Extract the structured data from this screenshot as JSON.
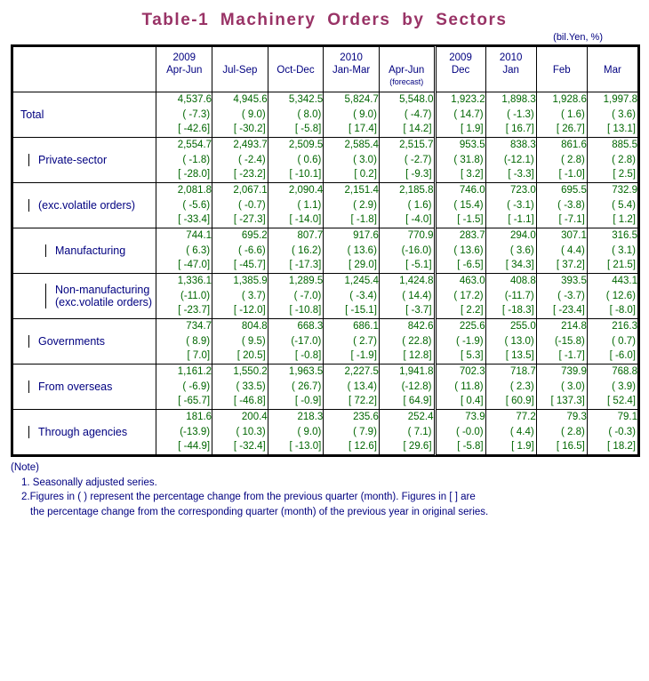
{
  "title": "Table-1  Machinery  Orders  by  Sectors",
  "units": "(bil.Yen, %)",
  "colors": {
    "title": "#993366",
    "label": "#000080",
    "value": "#006600",
    "border": "#000000"
  },
  "header": {
    "corner": "",
    "columns": [
      {
        "year": "2009",
        "period": "Apr-Jun",
        "sub": ""
      },
      {
        "year": "",
        "period": "Jul-Sep",
        "sub": ""
      },
      {
        "year": "",
        "period": "Oct-Dec",
        "sub": ""
      },
      {
        "year": "2010",
        "period": "Jan-Mar",
        "sub": ""
      },
      {
        "year": "",
        "period": "Apr-Jun",
        "sub": "(forecast)"
      },
      {
        "year": "2009",
        "period": "Dec",
        "sub": ""
      },
      {
        "year": "2010",
        "period": "Jan",
        "sub": ""
      },
      {
        "year": "",
        "period": "Feb",
        "sub": ""
      },
      {
        "year": "",
        "period": "Mar",
        "sub": ""
      }
    ]
  },
  "rows": [
    {
      "label": "Total",
      "label2": "",
      "level": 0,
      "cells": [
        {
          "value": "4,537.6",
          "qoq": "( -7.3)",
          "yoy": "[ -42.6]"
        },
        {
          "value": "4,945.6",
          "qoq": "(  9.0)",
          "yoy": "[ -30.2]"
        },
        {
          "value": "5,342.5",
          "qoq": "(  8.0)",
          "yoy": "[  -5.8]"
        },
        {
          "value": "5,824.7",
          "qoq": "(  9.0)",
          "yoy": "[  17.4]"
        },
        {
          "value": "5,548.0",
          "qoq": "( -4.7)",
          "yoy": "[  14.2]"
        },
        {
          "value": "1,923.2",
          "qoq": "( 14.7)",
          "yoy": "[   1.9]"
        },
        {
          "value": "1,898.3",
          "qoq": "( -1.3)",
          "yoy": "[  16.7]"
        },
        {
          "value": "1,928.6",
          "qoq": "(  1.6)",
          "yoy": "[  26.7]"
        },
        {
          "value": "1,997.8",
          "qoq": "(  3.6)",
          "yoy": "[  13.1]"
        }
      ]
    },
    {
      "label": "Private-sector",
      "label2": "",
      "level": 1,
      "cells": [
        {
          "value": "2,554.7",
          "qoq": "( -1.8)",
          "yoy": "[ -28.0]"
        },
        {
          "value": "2,493.7",
          "qoq": "( -2.4)",
          "yoy": "[ -23.2]"
        },
        {
          "value": "2,509.5",
          "qoq": "(  0.6)",
          "yoy": "[ -10.1]"
        },
        {
          "value": "2,585.4",
          "qoq": "(  3.0)",
          "yoy": "[   0.2]"
        },
        {
          "value": "2,515.7",
          "qoq": "( -2.7)",
          "yoy": "[  -9.3]"
        },
        {
          "value": "953.5",
          "qoq": "( 31.8)",
          "yoy": "[   3.2]"
        },
        {
          "value": "838.3",
          "qoq": "(-12.1)",
          "yoy": "[  -3.3]"
        },
        {
          "value": "861.6",
          "qoq": "(  2.8)",
          "yoy": "[  -1.0]"
        },
        {
          "value": "885.5",
          "qoq": "(  2.8)",
          "yoy": "[   2.5]"
        }
      ]
    },
    {
      "label": "(exc.volatile orders)",
      "label2": "",
      "level": 1,
      "cells": [
        {
          "value": "2,081.8",
          "qoq": "( -5.6)",
          "yoy": "[ -33.4]"
        },
        {
          "value": "2,067.1",
          "qoq": "( -0.7)",
          "yoy": "[ -27.3]"
        },
        {
          "value": "2,090.4",
          "qoq": "(  1.1)",
          "yoy": "[ -14.0]"
        },
        {
          "value": "2,151.4",
          "qoq": "(  2.9)",
          "yoy": "[  -1.8]"
        },
        {
          "value": "2,185.8",
          "qoq": "(  1.6)",
          "yoy": "[  -4.0]"
        },
        {
          "value": "746.0",
          "qoq": "( 15.4)",
          "yoy": "[  -1.5]"
        },
        {
          "value": "723.0",
          "qoq": "( -3.1)",
          "yoy": "[  -1.1]"
        },
        {
          "value": "695.5",
          "qoq": "( -3.8)",
          "yoy": "[  -7.1]"
        },
        {
          "value": "732.9",
          "qoq": "(  5.4)",
          "yoy": "[   1.2]"
        }
      ]
    },
    {
      "label": "Manufacturing",
      "label2": "",
      "level": 2,
      "cells": [
        {
          "value": "744.1",
          "qoq": "(  6.3)",
          "yoy": "[ -47.0]"
        },
        {
          "value": "695.2",
          "qoq": "( -6.6)",
          "yoy": "[ -45.7]"
        },
        {
          "value": "807.7",
          "qoq": "( 16.2)",
          "yoy": "[ -17.3]"
        },
        {
          "value": "917.6",
          "qoq": "( 13.6)",
          "yoy": "[  29.0]"
        },
        {
          "value": "770.9",
          "qoq": "(-16.0)",
          "yoy": "[  -5.1]"
        },
        {
          "value": "283.7",
          "qoq": "( 13.6)",
          "yoy": "[  -6.5]"
        },
        {
          "value": "294.0",
          "qoq": "(  3.6)",
          "yoy": "[  34.3]"
        },
        {
          "value": "307.1",
          "qoq": "(  4.4)",
          "yoy": "[  37.2]"
        },
        {
          "value": "316.5",
          "qoq": "(  3.1)",
          "yoy": "[  21.5]"
        }
      ]
    },
    {
      "label": "Non-manufacturing",
      "label2": "(exc.volatile orders)",
      "level": 2,
      "cells": [
        {
          "value": "1,336.1",
          "qoq": "(-11.0)",
          "yoy": "[ -23.7]"
        },
        {
          "value": "1,385.9",
          "qoq": "(  3.7)",
          "yoy": "[ -12.0]"
        },
        {
          "value": "1,289.5",
          "qoq": "( -7.0)",
          "yoy": "[ -10.8]"
        },
        {
          "value": "1,245.4",
          "qoq": "( -3.4)",
          "yoy": "[ -15.1]"
        },
        {
          "value": "1,424.8",
          "qoq": "( 14.4)",
          "yoy": "[  -3.7]"
        },
        {
          "value": "463.0",
          "qoq": "( 17.2)",
          "yoy": "[   2.2]"
        },
        {
          "value": "408.8",
          "qoq": "(-11.7)",
          "yoy": "[ -18.3]"
        },
        {
          "value": "393.5",
          "qoq": "( -3.7)",
          "yoy": "[ -23.4]"
        },
        {
          "value": "443.1",
          "qoq": "( 12.6)",
          "yoy": "[  -8.0]"
        }
      ]
    },
    {
      "label": "Governments",
      "label2": "",
      "level": 1,
      "cells": [
        {
          "value": "734.7",
          "qoq": "(  8.9)",
          "yoy": "[   7.0]"
        },
        {
          "value": "804.8",
          "qoq": "(  9.5)",
          "yoy": "[  20.5]"
        },
        {
          "value": "668.3",
          "qoq": "(-17.0)",
          "yoy": "[  -0.8]"
        },
        {
          "value": "686.1",
          "qoq": "(  2.7)",
          "yoy": "[  -1.9]"
        },
        {
          "value": "842.6",
          "qoq": "( 22.8)",
          "yoy": "[  12.8]"
        },
        {
          "value": "225.6",
          "qoq": "( -1.9)",
          "yoy": "[   5.3]"
        },
        {
          "value": "255.0",
          "qoq": "( 13.0)",
          "yoy": "[  13.5]"
        },
        {
          "value": "214.8",
          "qoq": "(-15.8)",
          "yoy": "[  -1.7]"
        },
        {
          "value": "216.3",
          "qoq": "(  0.7)",
          "yoy": "[  -6.0]"
        }
      ]
    },
    {
      "label": "From overseas",
      "label2": "",
      "level": 1,
      "cells": [
        {
          "value": "1,161.2",
          "qoq": "( -6.9)",
          "yoy": "[ -65.7]"
        },
        {
          "value": "1,550.2",
          "qoq": "( 33.5)",
          "yoy": "[ -46.8]"
        },
        {
          "value": "1,963.5",
          "qoq": "( 26.7)",
          "yoy": "[  -0.9]"
        },
        {
          "value": "2,227.5",
          "qoq": "( 13.4)",
          "yoy": "[  72.2]"
        },
        {
          "value": "1,941.8",
          "qoq": "(-12.8)",
          "yoy": "[  64.9]"
        },
        {
          "value": "702.3",
          "qoq": "( 11.8)",
          "yoy": "[   0.4]"
        },
        {
          "value": "718.7",
          "qoq": "(  2.3)",
          "yoy": "[  60.9]"
        },
        {
          "value": "739.9",
          "qoq": "(  3.0)",
          "yoy": "[ 137.3]"
        },
        {
          "value": "768.8",
          "qoq": "(  3.9)",
          "yoy": "[  52.4]"
        }
      ]
    },
    {
      "label": "Through agencies",
      "label2": "",
      "level": 1,
      "cells": [
        {
          "value": "181.6",
          "qoq": "(-13.9)",
          "yoy": "[ -44.9]"
        },
        {
          "value": "200.4",
          "qoq": "( 10.3)",
          "yoy": "[ -32.4]"
        },
        {
          "value": "218.3",
          "qoq": "(  9.0)",
          "yoy": "[ -13.0]"
        },
        {
          "value": "235.6",
          "qoq": "(  7.9)",
          "yoy": "[  12.6]"
        },
        {
          "value": "252.4",
          "qoq": "(  7.1)",
          "yoy": "[  29.6]"
        },
        {
          "value": "73.9",
          "qoq": "( -0.0)",
          "yoy": "[  -5.8]"
        },
        {
          "value": "77.2",
          "qoq": "(  4.4)",
          "yoy": "[   1.9]"
        },
        {
          "value": "79.3",
          "qoq": "(  2.8)",
          "yoy": "[  16.5]"
        },
        {
          "value": "79.1",
          "qoq": "( -0.3)",
          "yoy": "[  18.2]"
        }
      ]
    }
  ],
  "notes": {
    "head": "(Note)",
    "n1": "1. Seasonally adjusted series.",
    "n2a": "2.Figures in ( ) represent the percentage change from the previous quarter (month). Figures in [ ] are",
    "n2b": "the percentage change from the corresponding quarter (month) of the previous year in original series."
  }
}
